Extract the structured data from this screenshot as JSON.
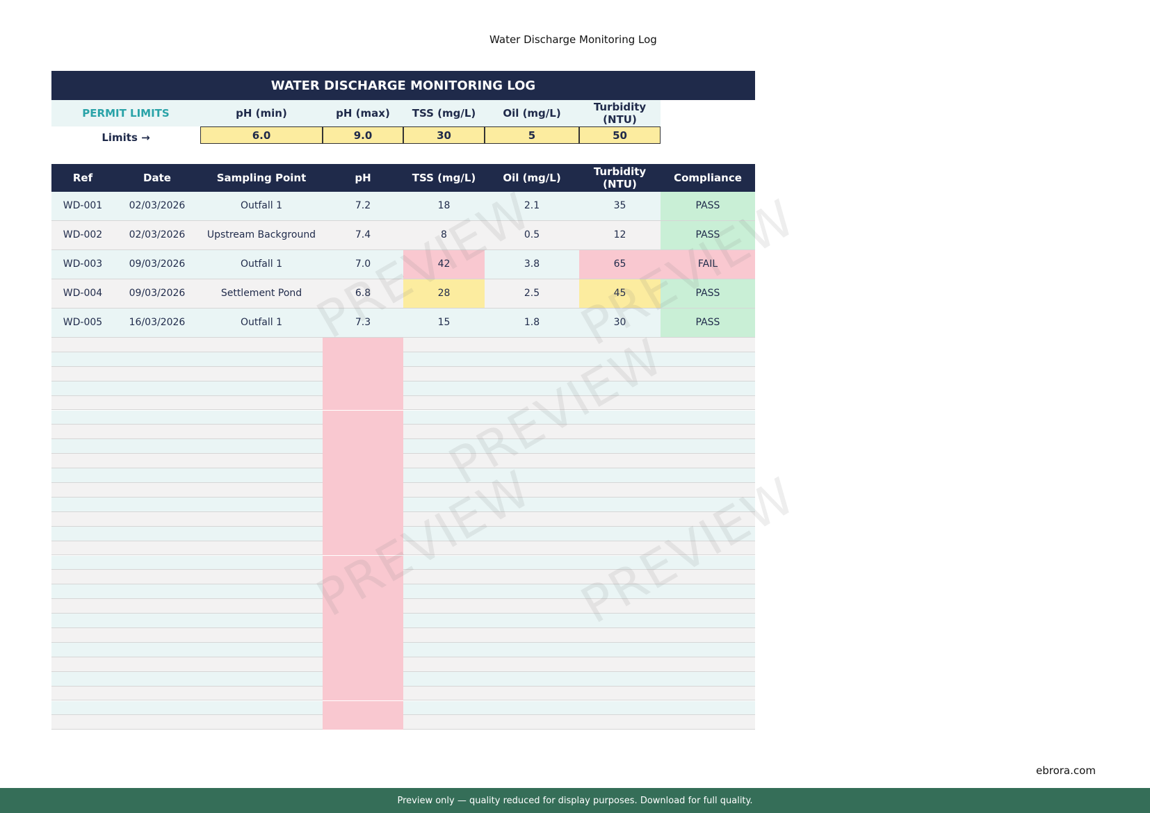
{
  "page_header": "Water Discharge Monitoring Log",
  "title": "WATER DISCHARGE MONITORING LOG",
  "limits": {
    "label": "PERMIT LIMITS",
    "arrow_label": "Limits →",
    "headers": [
      "pH (min)",
      "pH (max)",
      "TSS (mg/L)",
      "Oil (mg/L)",
      "Turbidity\n(NTU)"
    ],
    "values": [
      "6.0",
      "9.0",
      "30",
      "5",
      "50"
    ]
  },
  "table": {
    "headers": [
      "Ref",
      "Date",
      "Sampling Point",
      "pH",
      "TSS (mg/L)",
      "Oil (mg/L)",
      "Turbidity\n(NTU)",
      "Compliance"
    ],
    "rows": [
      {
        "ref": "WD-001",
        "date": "02/03/2026",
        "point": "Outfall 1",
        "ph": "7.2",
        "tss": "18",
        "oil": "2.1",
        "turbidity": "35",
        "compliance": "PASS",
        "tss_status": "ok",
        "turb_status": "ok"
      },
      {
        "ref": "WD-002",
        "date": "02/03/2026",
        "point": "Upstream Background",
        "ph": "7.4",
        "tss": "8",
        "oil": "0.5",
        "turbidity": "12",
        "compliance": "PASS",
        "tss_status": "ok",
        "turb_status": "ok"
      },
      {
        "ref": "WD-003",
        "date": "09/03/2026",
        "point": "Outfall 1",
        "ph": "7.0",
        "tss": "42",
        "oil": "3.8",
        "turbidity": "65",
        "compliance": "FAIL",
        "tss_status": "fail",
        "turb_status": "fail"
      },
      {
        "ref": "WD-004",
        "date": "09/03/2026",
        "point": "Settlement Pond",
        "ph": "6.8",
        "tss": "28",
        "oil": "2.5",
        "turbidity": "45",
        "compliance": "PASS",
        "tss_status": "warn",
        "turb_status": "warn"
      },
      {
        "ref": "WD-005",
        "date": "16/03/2026",
        "point": "Outfall 1",
        "ph": "7.3",
        "tss": "15",
        "oil": "1.8",
        "turbidity": "30",
        "compliance": "PASS",
        "tss_status": "ok",
        "turb_status": "ok"
      }
    ],
    "empty_row_count": 27
  },
  "watermark_text": "PREVIEW",
  "site": "ebrora.com",
  "footer": "Preview only  —  quality reduced for display purposes.  Download for full quality.",
  "colors": {
    "navy": "#1f2a4a",
    "teal_label": "#2aa3a8",
    "pass": "#c9efd6",
    "fail": "#f9c8d0",
    "warn": "#fcec9f",
    "footer_green": "#356e58"
  }
}
